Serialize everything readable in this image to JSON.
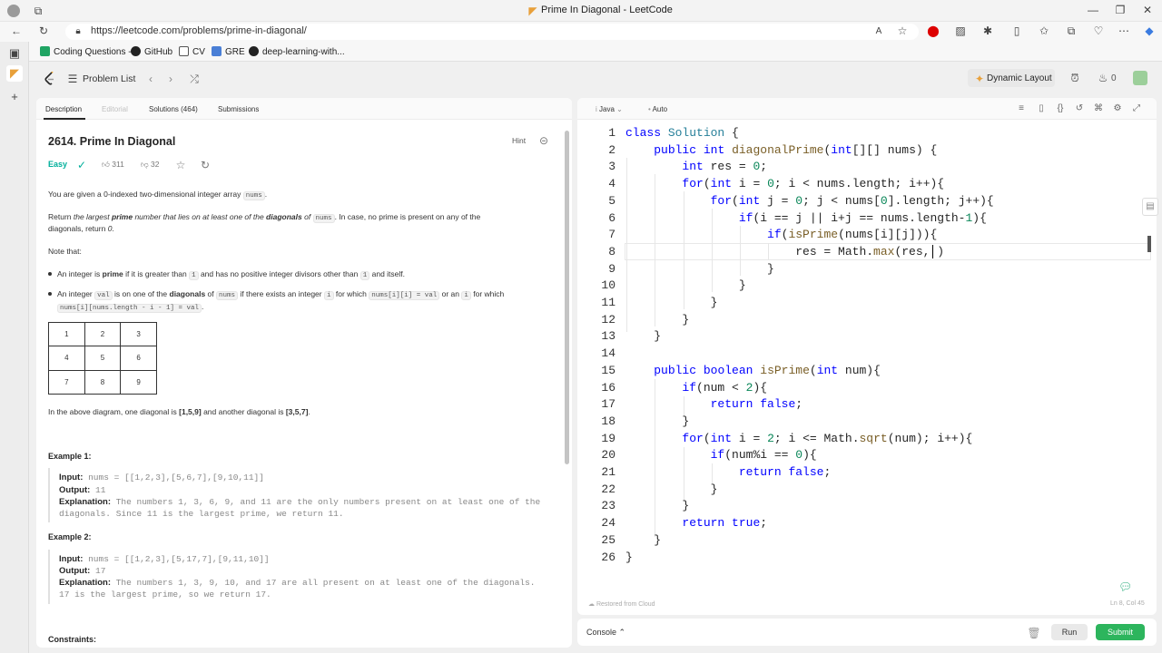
{
  "browser": {
    "tab_title": "Prime In Diagonal - LeetCode",
    "url": "https://leetcode.com/problems/prime-in-diagonal/",
    "bookmarks": [
      "Coding Questions -...",
      "GitHub",
      "CV",
      "GRE",
      "deep-learning-with..."
    ]
  },
  "header": {
    "problem_list": "Problem List",
    "dynamic_layout": "Dynamic Layout",
    "coins": "0"
  },
  "left_tabs": {
    "description": "Description",
    "editorial": "Editorial",
    "solutions": "Solutions (464)",
    "submissions": "Submissions"
  },
  "problem": {
    "title": "2614. Prime In Diagonal",
    "hint": "Hint",
    "difficulty": "Easy",
    "likes": "311",
    "dislikes": "32",
    "p1_a": "You are given a 0-indexed two-dimensional integer array ",
    "p1_code": "nums",
    "p1_b": ".",
    "p2_a": "Return ",
    "p2_b": "the largest ",
    "p2_c": "prime",
    "p2_d": " number that lies on at least one of the ",
    "p2_e": "diagonals",
    "p2_f": " of ",
    "p2_code": "nums",
    "p2_g": ". In case, no prime is present on any of the",
    "p2_line2_a": "diagonals, return ",
    "p2_line2_b": "0",
    "p2_line2_c": ".",
    "note": "Note that:",
    "b1_a": "An integer is ",
    "b1_b": "prime",
    "b1_c": " if it is greater than ",
    "b1_code1": "1",
    "b1_d": " and has no positive integer divisors other than ",
    "b1_code2": "1",
    "b1_e": " and itself.",
    "b2_a": "An integer ",
    "b2_code1": "val",
    "b2_b": " is on one of the ",
    "b2_c": "diagonals",
    "b2_d": " of ",
    "b2_code2": "nums",
    "b2_e": " if there exists an integer ",
    "b2_code3": "i",
    "b2_f": " for which ",
    "b2_code4": "nums[i][i] = val",
    "b2_g": " or an ",
    "b2_code5": "i",
    "b2_h": " for which",
    "b2_code6": "nums[i][nums.length - i - 1] = val",
    "b2_i": ".",
    "grid": [
      [
        "1",
        "2",
        "3"
      ],
      [
        "4",
        "5",
        "6"
      ],
      [
        "7",
        "8",
        "9"
      ]
    ],
    "diag_a": "In the above diagram, one diagonal is ",
    "diag_b": "[1,5,9]",
    "diag_c": " and another diagonal is ",
    "diag_d": "[3,5,7]",
    "diag_e": ".",
    "ex1_title": "Example 1:",
    "ex1_input_label": "Input:",
    "ex1_input": "nums = [[1,2,3],[5,6,7],[9,10,11]]",
    "ex1_output_label": "Output:",
    "ex1_output": "11",
    "ex1_expl_label": "Explanation:",
    "ex1_expl_1": "The numbers 1, 3, 6, 9, and 11 are the only numbers present on at least one of the",
    "ex1_expl_2": "diagonals. Since 11 is the largest prime, we return 11.",
    "ex2_title": "Example 2:",
    "ex2_input_label": "Input:",
    "ex2_input": "nums = [[1,2,3],[5,17,7],[9,11,10]]",
    "ex2_output_label": "Output:",
    "ex2_output": "17",
    "ex2_expl_label": "Explanation:",
    "ex2_expl_1": "The numbers 1, 3, 9, 10, and 17 are all present on at least one of the diagonals.",
    "ex2_expl_2": "17 is the largest prime, so we return 17.",
    "constraints": "Constraints:"
  },
  "editor": {
    "language": "Java",
    "auto": "Auto",
    "restored": "Restored from Cloud",
    "position": "Ln 8, Col 45",
    "line_numbers": [
      "1",
      "2",
      "3",
      "4",
      "5",
      "6",
      "7",
      "8",
      "9",
      "10",
      "11",
      "12",
      "13",
      "14",
      "15",
      "16",
      "17",
      "18",
      "19",
      "20",
      "21",
      "22",
      "23",
      "24",
      "25",
      "26"
    ]
  },
  "console": {
    "label": "Console",
    "run": "Run",
    "submit": "Submit"
  },
  "colors": {
    "easy": "#00af9b",
    "submit": "#2db55d",
    "keyword": "#0000ff",
    "type": "#267f99",
    "function": "#795e26",
    "number": "#098658"
  }
}
